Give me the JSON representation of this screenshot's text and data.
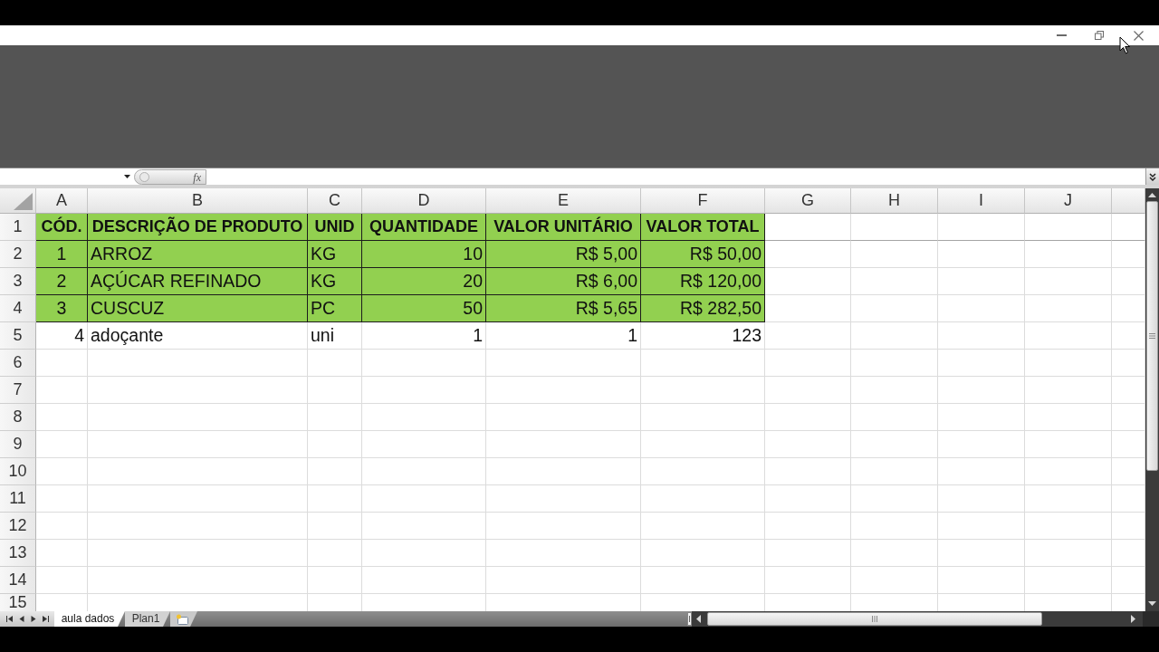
{
  "formula_bar": {
    "function_label": "fx"
  },
  "sheet": {
    "columns": [
      "A",
      "B",
      "C",
      "D",
      "E",
      "F",
      "G",
      "H",
      "I",
      "J"
    ],
    "rows": [
      {
        "number": "1",
        "kind": "header",
        "cells": [
          {
            "text": "CÓD.",
            "kind": "centered"
          },
          {
            "text": "DESCRIÇÃO DE PRODUTO",
            "kind": "centered"
          },
          {
            "text": "UNID",
            "kind": "centered"
          },
          {
            "text": "QUANTIDADE",
            "kind": "centered"
          },
          {
            "text": "VALOR UNITÁRIO",
            "kind": "centered"
          },
          {
            "text": "VALOR TOTAL",
            "kind": "centered"
          }
        ]
      },
      {
        "number": "2",
        "kind": "filled",
        "cells": [
          {
            "text": "1",
            "kind": "centered"
          },
          {
            "text": "ARROZ",
            "kind": "text"
          },
          {
            "text": "KG",
            "kind": "text"
          },
          {
            "text": "10",
            "kind": "number"
          },
          {
            "text": "R$ 5,00",
            "kind": "number"
          },
          {
            "text": "R$ 50,00",
            "kind": "number"
          }
        ]
      },
      {
        "number": "3",
        "kind": "filled",
        "cells": [
          {
            "text": "2",
            "kind": "centered"
          },
          {
            "text": "AÇÚCAR REFINADO",
            "kind": "text"
          },
          {
            "text": "KG",
            "kind": "text"
          },
          {
            "text": "20",
            "kind": "number"
          },
          {
            "text": "R$ 6,00",
            "kind": "number"
          },
          {
            "text": "R$ 120,00",
            "kind": "number"
          }
        ]
      },
      {
        "number": "4",
        "kind": "filled",
        "cells": [
          {
            "text": "3",
            "kind": "centered"
          },
          {
            "text": "CUSCUZ",
            "kind": "text"
          },
          {
            "text": "PC",
            "kind": "text"
          },
          {
            "text": "50",
            "kind": "number"
          },
          {
            "text": "R$ 5,65",
            "kind": "number"
          },
          {
            "text": "R$ 282,50",
            "kind": "number"
          }
        ]
      },
      {
        "number": "5",
        "kind": "plain",
        "cells": [
          {
            "text": "4",
            "kind": "number"
          },
          {
            "text": "adoçante",
            "kind": "text"
          },
          {
            "text": "uni",
            "kind": "text"
          },
          {
            "text": "1",
            "kind": "number"
          },
          {
            "text": "1",
            "kind": "number"
          },
          {
            "text": "123",
            "kind": "number"
          }
        ]
      },
      {
        "number": "6"
      },
      {
        "number": "7"
      },
      {
        "number": "8"
      },
      {
        "number": "9"
      },
      {
        "number": "10"
      },
      {
        "number": "11"
      },
      {
        "number": "12"
      },
      {
        "number": "13"
      },
      {
        "number": "14"
      },
      {
        "number": "15"
      }
    ]
  },
  "sheet_tabs": [
    {
      "label": "aula dados",
      "selected": true
    },
    {
      "label": "Plan1",
      "selected": false
    }
  ]
}
